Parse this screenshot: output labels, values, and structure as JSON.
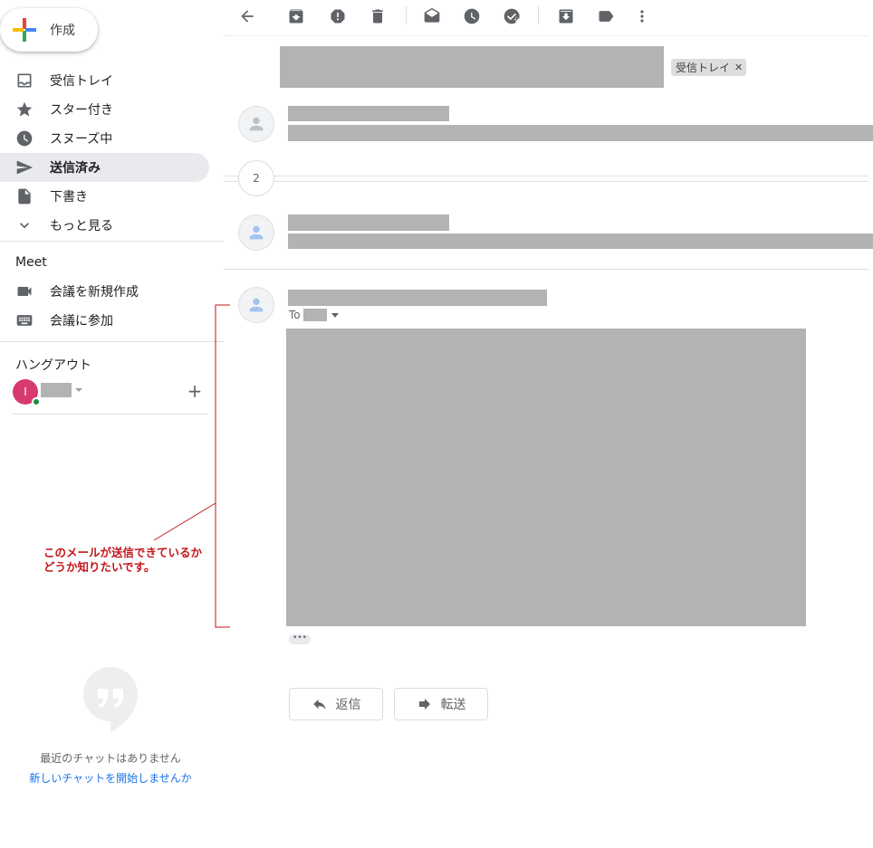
{
  "compose": {
    "label": "作成"
  },
  "nav": {
    "items": [
      {
        "label": "受信トレイ",
        "icon": "inbox-icon"
      },
      {
        "label": "スター付き",
        "icon": "star-icon"
      },
      {
        "label": "スヌーズ中",
        "icon": "clock-icon"
      },
      {
        "label": "送信済み",
        "icon": "send-icon",
        "active": true
      },
      {
        "label": "下書き",
        "icon": "draft-icon"
      },
      {
        "label": "もっと見る",
        "icon": "chevron-down-icon"
      }
    ]
  },
  "meet": {
    "heading": "Meet",
    "items": [
      {
        "label": "会議を新規作成",
        "icon": "video-camera-icon"
      },
      {
        "label": "会議に参加",
        "icon": "keyboard-icon"
      }
    ]
  },
  "hangouts": {
    "heading": "ハングアウト",
    "user_initial": "I",
    "no_chats": "最近のチャットはありません",
    "start_chat": "新しいチャットを開始しませんか"
  },
  "toolbar": {
    "icons": [
      "back-arrow-icon",
      "archive-icon",
      "report-spam-icon",
      "delete-icon",
      "mark-unread-icon",
      "snooze-icon",
      "add-task-icon",
      "move-to-icon",
      "label-icon",
      "more-vert-icon"
    ]
  },
  "thread": {
    "label_chip": "受信トレイ",
    "collapsed_count": "2",
    "to_prefix": "To"
  },
  "actions": {
    "reply": "返信",
    "forward": "転送"
  },
  "annotation": {
    "line1": "このメールが送信できているか",
    "line2": "どうか知りたいです。"
  },
  "colors": {
    "accent_blue": "#1a73e8",
    "active_nav_bg": "#e8eaed",
    "annotation_red": "#c4161c",
    "redaction_gray": "#b3b3b3"
  }
}
